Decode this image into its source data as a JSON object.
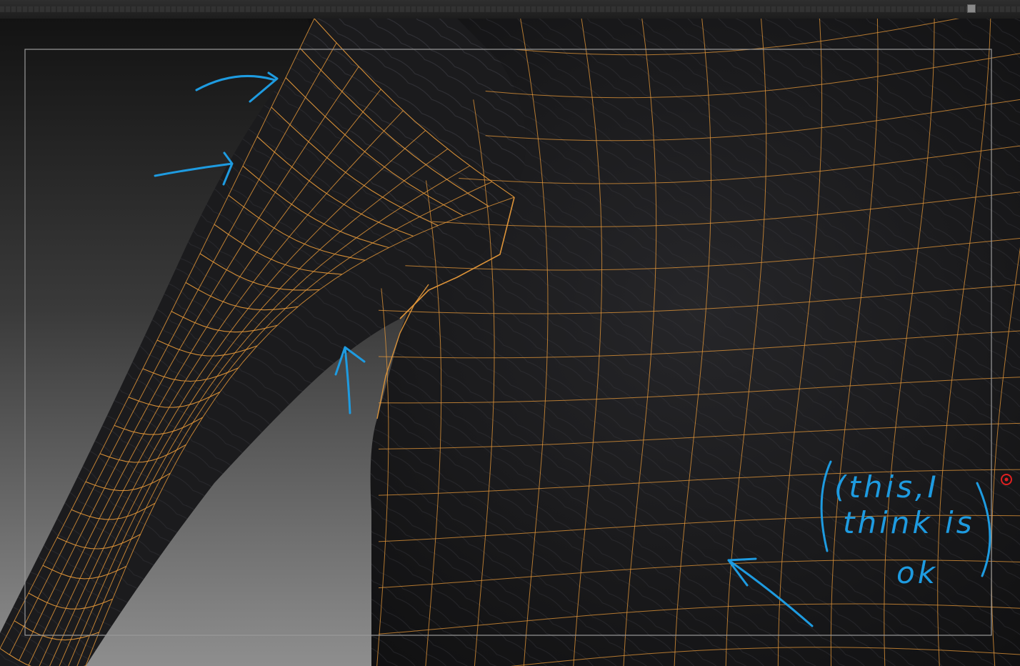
{
  "app": {
    "mode": "retopology wireframe over sculpt"
  },
  "colors": {
    "background_top": "#141414",
    "background_bottom": "#8c8c8c",
    "mesh_surface": "#1b1b1d",
    "wireframe": "#e89a3a",
    "annotation": "#1e9be0",
    "gizmo_red": "#e02020",
    "frame_border": "#9a9a9a"
  },
  "annotation_note": {
    "line1": "(this,I",
    "line2": "think is",
    "line3": "ok"
  },
  "icons": {
    "gizmo": "red-circle-gizmo",
    "arrows": [
      "arrow-shoulder-top",
      "arrow-shoulder-side",
      "arrow-armpit",
      "arrow-waist"
    ]
  }
}
